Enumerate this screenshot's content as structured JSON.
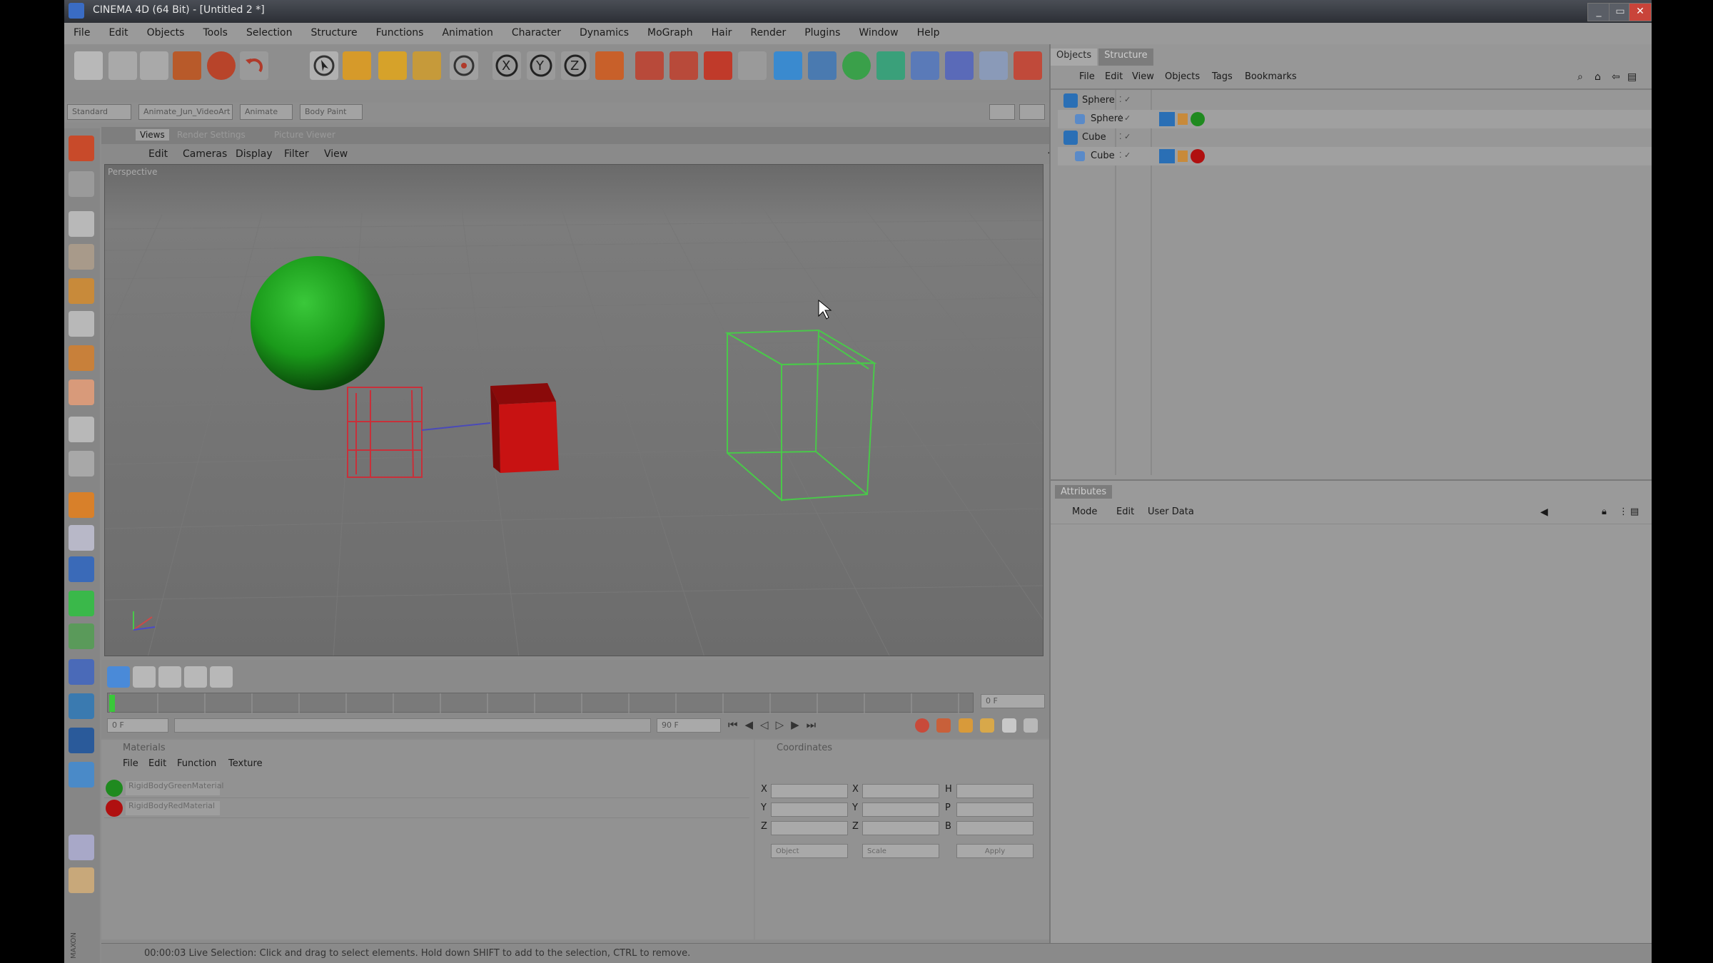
{
  "window": {
    "title": "CINEMA 4D (64 Bit) - [Untitled 2 *]"
  },
  "menubar": [
    "File",
    "Edit",
    "Objects",
    "Tools",
    "Selection",
    "Structure",
    "Functions",
    "Animation",
    "Character",
    "Dynamics",
    "MoGraph",
    "Hair",
    "Render",
    "Plugins",
    "Window",
    "Help"
  ],
  "layouts": [
    "Standard",
    "Animate_Jun_VideoArt",
    "Animate",
    "Body Paint"
  ],
  "viewport": {
    "tabs": [
      "Views",
      "Render Settings",
      "Picture Viewer"
    ],
    "menu": [
      "Edit",
      "Cameras",
      "Display",
      "Filter",
      "View"
    ],
    "label": "Perspective"
  },
  "timeline": {
    "start_field": "0 F",
    "end_field": "90 F",
    "current_field": "0 F",
    "right_field": "0 F"
  },
  "materials": {
    "title": "Materials",
    "menu": [
      "File",
      "Edit",
      "Function",
      "Texture"
    ],
    "items": [
      {
        "name": "RigidBodyGreenMaterial",
        "color": "#1f8a1f"
      },
      {
        "name": "RigidBodyRedMaterial",
        "color": "#b01010"
      }
    ]
  },
  "coordinates": {
    "title": "Coordinates",
    "rows": [
      {
        "a": "X",
        "b": "X",
        "c": "H"
      },
      {
        "a": "Y",
        "b": "Y",
        "c": "P"
      },
      {
        "a": "Z",
        "b": "Z",
        "c": "B"
      }
    ],
    "dropdown1": "Object",
    "dropdown2": "Scale",
    "apply": "Apply"
  },
  "objects": {
    "tabs": [
      "Objects",
      "Structure"
    ],
    "menu": [
      "File",
      "Edit",
      "View",
      "Objects",
      "Tags",
      "Bookmarks"
    ],
    "rows": [
      {
        "name": "Sphere",
        "indent": 0,
        "tag_color": ""
      },
      {
        "name": "Sphere",
        "indent": 1,
        "tag_color": "#1f8a1f"
      },
      {
        "name": "Cube",
        "indent": 0,
        "tag_color": ""
      },
      {
        "name": "Cube",
        "indent": 1,
        "tag_color": "#b01010"
      }
    ]
  },
  "attributes": {
    "tab": "Attributes",
    "menu": [
      "Mode",
      "Edit",
      "User Data"
    ]
  },
  "statusbar": {
    "text": "00:00:03   Live Selection: Click and drag to select elements. Hold down SHIFT to add to the selection, CTRL to remove."
  },
  "colors": {
    "accent": "#3a6cc4",
    "sphere": "#1f8a1f",
    "cube": "#b01010",
    "close": "#c9443a"
  }
}
